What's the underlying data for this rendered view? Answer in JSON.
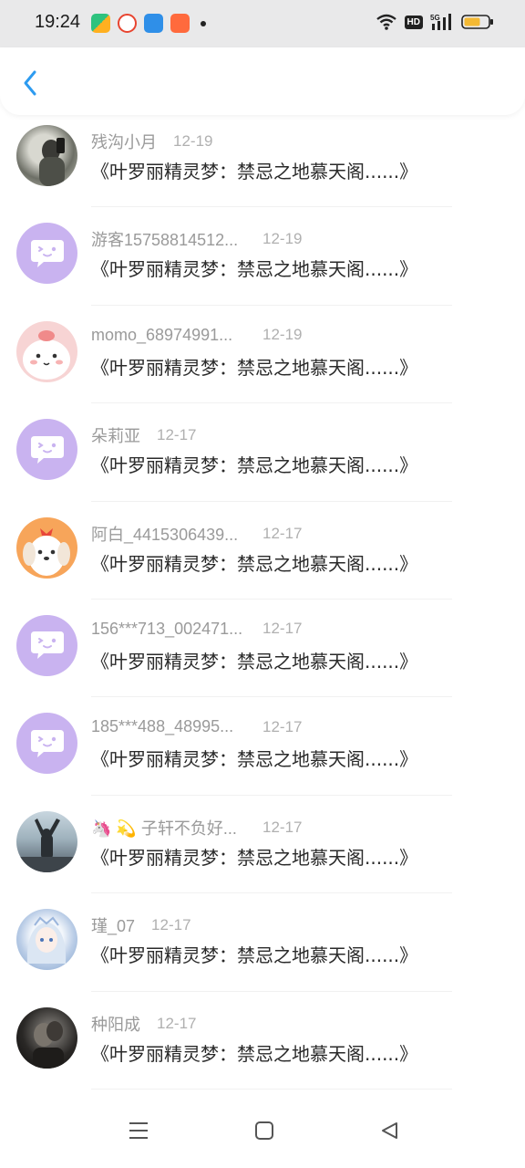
{
  "status_bar": {
    "time": "19:24",
    "hd_badge": "HD",
    "network": "5G",
    "icons": [
      "app-icon-1",
      "weibo-icon",
      "app-icon-3",
      "app-icon-4",
      "wifi-icon",
      "signal-icon",
      "battery-icon"
    ]
  },
  "nav": {
    "back_icon": "chevron-left-icon",
    "accent_color": "#2d9bf0"
  },
  "list": {
    "items": [
      {
        "name": "残沟小月",
        "date": "12-19",
        "title": "《叶罗丽精灵梦：禁忌之地慕天阁......》",
        "avatar": "photo"
      },
      {
        "name": "游客15758814512...",
        "date": "12-19",
        "title": "《叶罗丽精灵梦：禁忌之地慕天阁......》",
        "avatar": "default"
      },
      {
        "name": "momo_68974991...",
        "date": "12-19",
        "title": "《叶罗丽精灵梦：禁忌之地慕天阁......》",
        "avatar": "cartoon-pink"
      },
      {
        "name": "朵莉亚",
        "date": "12-17",
        "title": "《叶罗丽精灵梦：禁忌之地慕天阁......》",
        "avatar": "default"
      },
      {
        "name": "阿白_4415306439...",
        "date": "12-17",
        "title": "《叶罗丽精灵梦：禁忌之地慕天阁......》",
        "avatar": "cartoon-dog"
      },
      {
        "name": "156***713_002471...",
        "date": "12-17",
        "title": "《叶罗丽精灵梦：禁忌之地慕天阁......》",
        "avatar": "default"
      },
      {
        "name": "185***488_48995...",
        "date": "12-17",
        "title": "《叶罗丽精灵梦：禁忌之地慕天阁......》",
        "avatar": "default"
      },
      {
        "name": "🦄 💫 子轩不负好...",
        "date": "12-17",
        "title": "《叶罗丽精灵梦：禁忌之地慕天阁......》",
        "avatar": "photo-sky"
      },
      {
        "name": "瑾_07",
        "date": "12-17",
        "title": "《叶罗丽精灵梦：禁忌之地慕天阁......》",
        "avatar": "anime"
      },
      {
        "name": "种阳成",
        "date": "12-17",
        "title": "《叶罗丽精灵梦：禁忌之地慕天阁......》",
        "avatar": "photo-dark"
      }
    ]
  },
  "system_nav": {
    "icons": [
      "menu-icon",
      "home-icon",
      "back-triangle-icon"
    ]
  }
}
